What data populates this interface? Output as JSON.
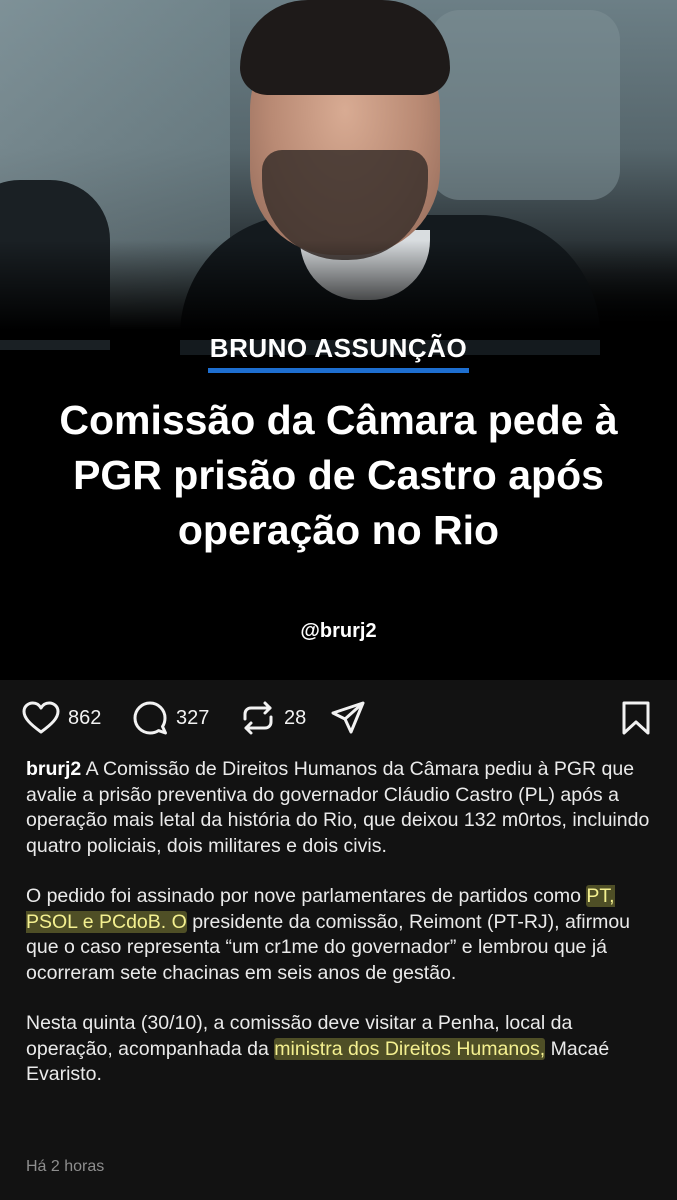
{
  "post": {
    "kicker": "BRUNO ASSUNÇÃO",
    "headline": "Comissão da Câmara pede à PGR prisão de Castro após operação no Rio",
    "handle_overlay": "@brurj2"
  },
  "actions": {
    "likes": "862",
    "comments": "327",
    "reposts": "28"
  },
  "caption": {
    "username": "brurj2",
    "p1": "A Comissão de Direitos Humanos da Câmara pediu à PGR que avalie a prisão preventiva do governador Cláudio Castro (PL) após a operação mais letal da história do Rio, que deixou 132 m0rtos, incluindo quatro policiais, dois militares e dois civis.",
    "p2_a": "O pedido foi assinado por nove parlamentares de partidos como ",
    "p2_hl": "PT, PSOL e PCdoB. O",
    "p2_b": " presidente da comissão, Reimont (PT-RJ), afirmou que o caso representa “um cr1me do governador” e lembrou que já ocorreram sete chacinas em seis anos de gestão.",
    "p3_a": "Nesta quinta (30/10), a comissão deve visitar a Penha, local da operação, acompanhada da ",
    "p3_hl": "ministra dos Direitos Humanos,",
    "p3_b": " Macaé Evaristo."
  },
  "timestamp": "Há 2 horas",
  "colors": {
    "kicker_underline": "#1e6fd0",
    "highlight": "#f4f090",
    "background": "#121212"
  },
  "icons": [
    "heart-icon",
    "comment-icon",
    "repost-icon",
    "share-icon",
    "bookmark-icon"
  ]
}
